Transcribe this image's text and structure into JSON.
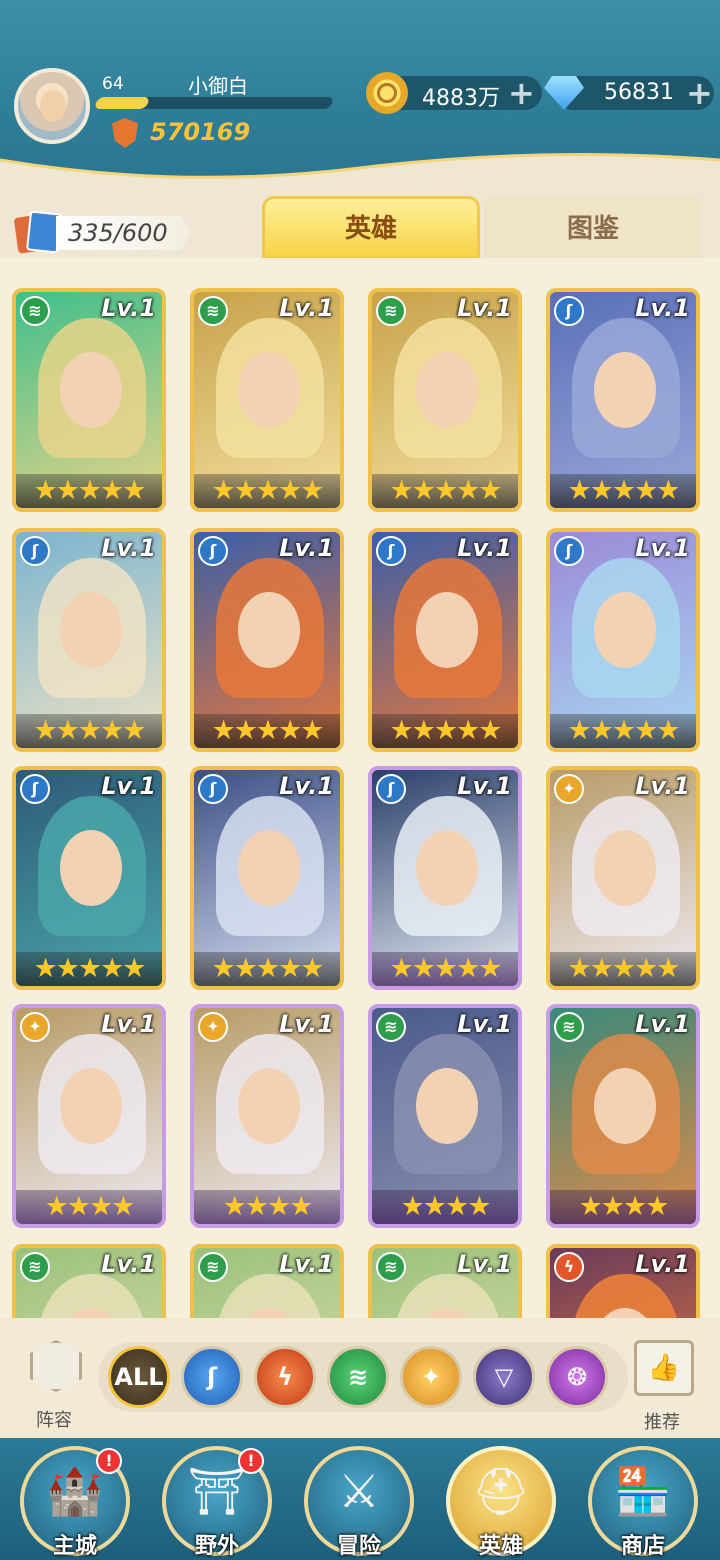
{
  "header": {
    "level": "64",
    "name": "小御白",
    "xp_progress": 0.22,
    "power": "570169",
    "gold": "4883万",
    "diamonds": "56831",
    "plus": "+"
  },
  "tabs": {
    "card_count": "335/600",
    "active": "英雄",
    "inactive": "图鉴"
  },
  "element_icons": {
    "wind": "wind-icon",
    "water": "water-icon",
    "fire": "fire-icon",
    "light": "light-icon",
    "dark": "dark-icon",
    "arcane": "arcane-icon"
  },
  "colors": {
    "wind": "#2f9e4c",
    "water": "#2e78c8",
    "fire": "#e2562a",
    "light": "#e8a62a",
    "dark": "#6b5aa8",
    "arcane": "#a24bc8",
    "gold_frame": "#f0c14a",
    "purple_frame": "#c89be6"
  },
  "heroes": [
    {
      "level": "Lv.1",
      "element": "wind",
      "stars": "★★★★★"
    },
    {
      "level": "Lv.1",
      "element": "wind",
      "stars": "★★★★★"
    },
    {
      "level": "Lv.1",
      "element": "wind",
      "stars": "★★★★★"
    },
    {
      "level": "Lv.1",
      "element": "water",
      "stars": "★★★★★"
    },
    {
      "level": "Lv.1",
      "element": "water",
      "stars": "★★★★★"
    },
    {
      "level": "Lv.1",
      "element": "water",
      "stars": "★★★★★"
    },
    {
      "level": "Lv.1",
      "element": "water",
      "stars": "★★★★★"
    },
    {
      "level": "Lv.1",
      "element": "water",
      "stars": "★★★★★"
    },
    {
      "level": "Lv.1",
      "element": "water",
      "stars": "★★★★★"
    },
    {
      "level": "Lv.1",
      "element": "water",
      "stars": "★★★★★"
    },
    {
      "level": "Lv.1",
      "element": "water",
      "stars": "★★★★★"
    },
    {
      "level": "Lv.1",
      "element": "light",
      "stars": "★★★★★"
    },
    {
      "level": "Lv.1",
      "element": "light",
      "stars": "★★★★"
    },
    {
      "level": "Lv.1",
      "element": "light",
      "stars": "★★★★"
    },
    {
      "level": "Lv.1",
      "element": "wind",
      "stars": "★★★★"
    },
    {
      "level": "Lv.1",
      "element": "wind",
      "stars": "★★★★"
    },
    {
      "level": "Lv.1",
      "element": "wind",
      "stars": ""
    },
    {
      "level": "Lv.1",
      "element": "wind",
      "stars": ""
    },
    {
      "level": "Lv.1",
      "element": "wind",
      "stars": ""
    },
    {
      "level": "Lv.1",
      "element": "fire",
      "stars": ""
    }
  ],
  "filters": {
    "lineup_label": "阵容",
    "all_label": "ALL",
    "recommend_label": "推荐"
  },
  "nav": {
    "main_city": "主城",
    "wild": "野外",
    "adventure": "冒险",
    "heroes": "英雄",
    "shop": "商店",
    "alert": "!"
  }
}
